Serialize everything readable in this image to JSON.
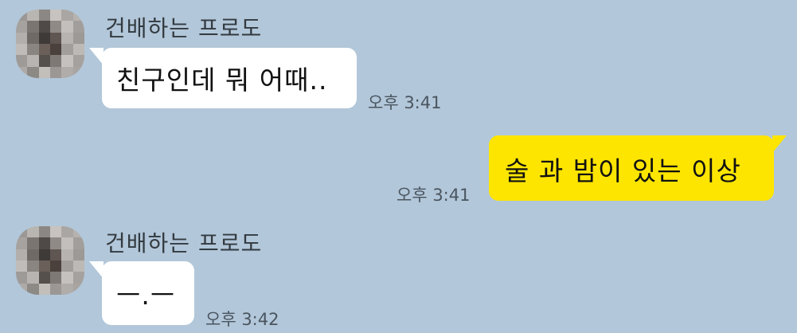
{
  "messages": [
    {
      "sender": "건배하는 프로도",
      "text": "친구인데 뭐 어때..",
      "time": "오후 3:41",
      "mine": false
    },
    {
      "sender": "",
      "text": "술 과 밤이 있는 이상",
      "time": "오후 3:41",
      "mine": true
    },
    {
      "sender": "건배하는 프로도",
      "text": "ㅡ.ㅡ",
      "time": "오후 3:42",
      "mine": false
    }
  ],
  "colors": {
    "background": "#b2c7d9",
    "my_bubble": "#fee500",
    "other_bubble": "#ffffff"
  },
  "icons": {
    "avatar": "blurred-profile-photo"
  }
}
